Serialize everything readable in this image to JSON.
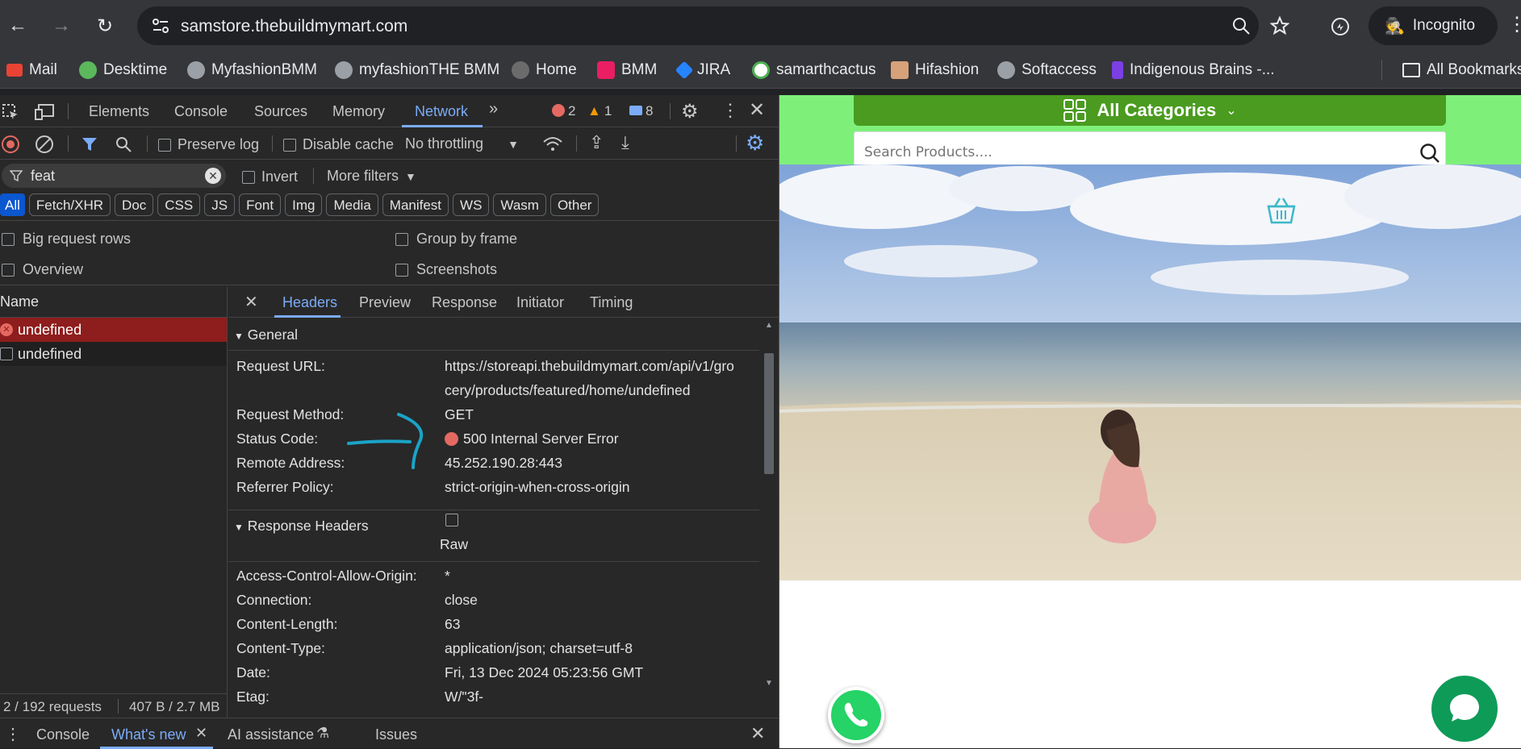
{
  "browser": {
    "url": "samstore.thebuildmymart.com",
    "incognito_label": "Incognito",
    "bookmarks": [
      {
        "label": "Mail",
        "color": "#ea4335"
      },
      {
        "label": "Desktime",
        "color": "#5cb85c"
      },
      {
        "label": "MyfashionBMM",
        "color": "#9aa0a6"
      },
      {
        "label": "myfashionTHE BMM",
        "color": "#9aa0a6"
      },
      {
        "label": "Home",
        "color": "#6b6b6b"
      },
      {
        "label": "BMM",
        "color": "#e91e63"
      },
      {
        "label": "JIRA",
        "color": "#2684ff"
      },
      {
        "label": "samarthcactus",
        "color": "#4caf50"
      },
      {
        "label": "Hifashion",
        "color": "#d7a17a"
      },
      {
        "label": "Softaccess",
        "color": "#9aa0a6"
      },
      {
        "label": "Indigenous Brains -...",
        "color": "#7b3fe4"
      }
    ],
    "all_bookmarks_label": "All Bookmarks"
  },
  "devtools": {
    "tabs": [
      "Elements",
      "Console",
      "Sources",
      "Memory",
      "Network"
    ],
    "active_tab": "Network",
    "more_tabs": "»",
    "errors_count": "2",
    "warnings_count": "1",
    "messages_count": "8",
    "toolbar": {
      "preserve_log": "Preserve log",
      "disable_cache": "Disable cache",
      "throttling": "No throttling"
    },
    "filter": {
      "value": "feat",
      "invert": "Invert",
      "more_filters": "More filters"
    },
    "type_filters": [
      "All",
      "Fetch/XHR",
      "Doc",
      "CSS",
      "JS",
      "Font",
      "Img",
      "Media",
      "Manifest",
      "WS",
      "Wasm",
      "Other"
    ],
    "options": {
      "big_request_rows": "Big request rows",
      "group_by_frame": "Group by frame",
      "overview": "Overview",
      "screenshots": "Screenshots"
    },
    "name_header": "Name",
    "requests": [
      "undefined",
      "undefined"
    ],
    "detail_tabs": [
      "Headers",
      "Preview",
      "Response",
      "Initiator",
      "Timing"
    ],
    "general": {
      "title": "General",
      "rows": [
        {
          "label": "Request URL:",
          "value": "https://storeapi.thebuildmymart.com/api/v1/gro",
          "value2": "cery/products/featured/home/undefined"
        },
        {
          "label": "Request Method:",
          "value": "GET"
        },
        {
          "label": "Status Code:",
          "value": "500 Internal Server Error"
        },
        {
          "label": "Remote Address:",
          "value": "45.252.190.28:443"
        },
        {
          "label": "Referrer Policy:",
          "value": "strict-origin-when-cross-origin"
        }
      ]
    },
    "response_headers": {
      "title": "Response Headers",
      "raw_label": "Raw",
      "rows": [
        {
          "label": "Access-Control-Allow-Origin:",
          "value": "*"
        },
        {
          "label": "Connection:",
          "value": "close"
        },
        {
          "label": "Content-Length:",
          "value": "63"
        },
        {
          "label": "Content-Type:",
          "value": "application/json; charset=utf-8"
        },
        {
          "label": "Date:",
          "value": "Fri, 13 Dec 2024 05:23:56 GMT"
        },
        {
          "label": "Etag:",
          "value": "W/\"3f-"
        }
      ]
    },
    "status_bar": {
      "requests": "2 / 192 requests",
      "transferred": "407 B / 2.7 MB"
    },
    "drawer_tabs": {
      "console": "Console",
      "whats_new": "What's new",
      "ai_assistance": "AI assistance",
      "issues": "Issues"
    }
  },
  "page": {
    "categories_label": "All Categories",
    "search_placeholder": "Search Products...."
  }
}
